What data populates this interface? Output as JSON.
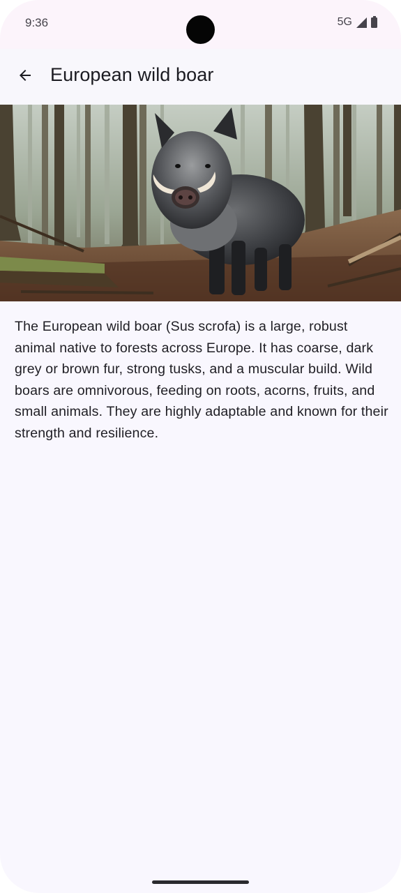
{
  "status_bar": {
    "time": "9:36",
    "network": "5G",
    "icons": [
      "signal-icon",
      "battery-icon"
    ]
  },
  "app_bar": {
    "back_icon": "arrow-back-icon",
    "title": "European wild boar"
  },
  "hero_image": {
    "subject": "wild-boar-in-forest-photo"
  },
  "description": "The European wild boar (Sus scrofa) is a large, robust animal native to forests across Europe. It has coarse, dark grey or brown fur, strong tusks, and a muscular build. Wild boars are omnivorous, feeding on roots, acorns, fruits, and small animals. They are highly adaptable and known for their strength and resilience.",
  "colors": {
    "background": "#f9f7fe",
    "status_bar": "#fcf4fb",
    "text_primary": "#1b1b21",
    "text_secondary": "#46434b"
  }
}
